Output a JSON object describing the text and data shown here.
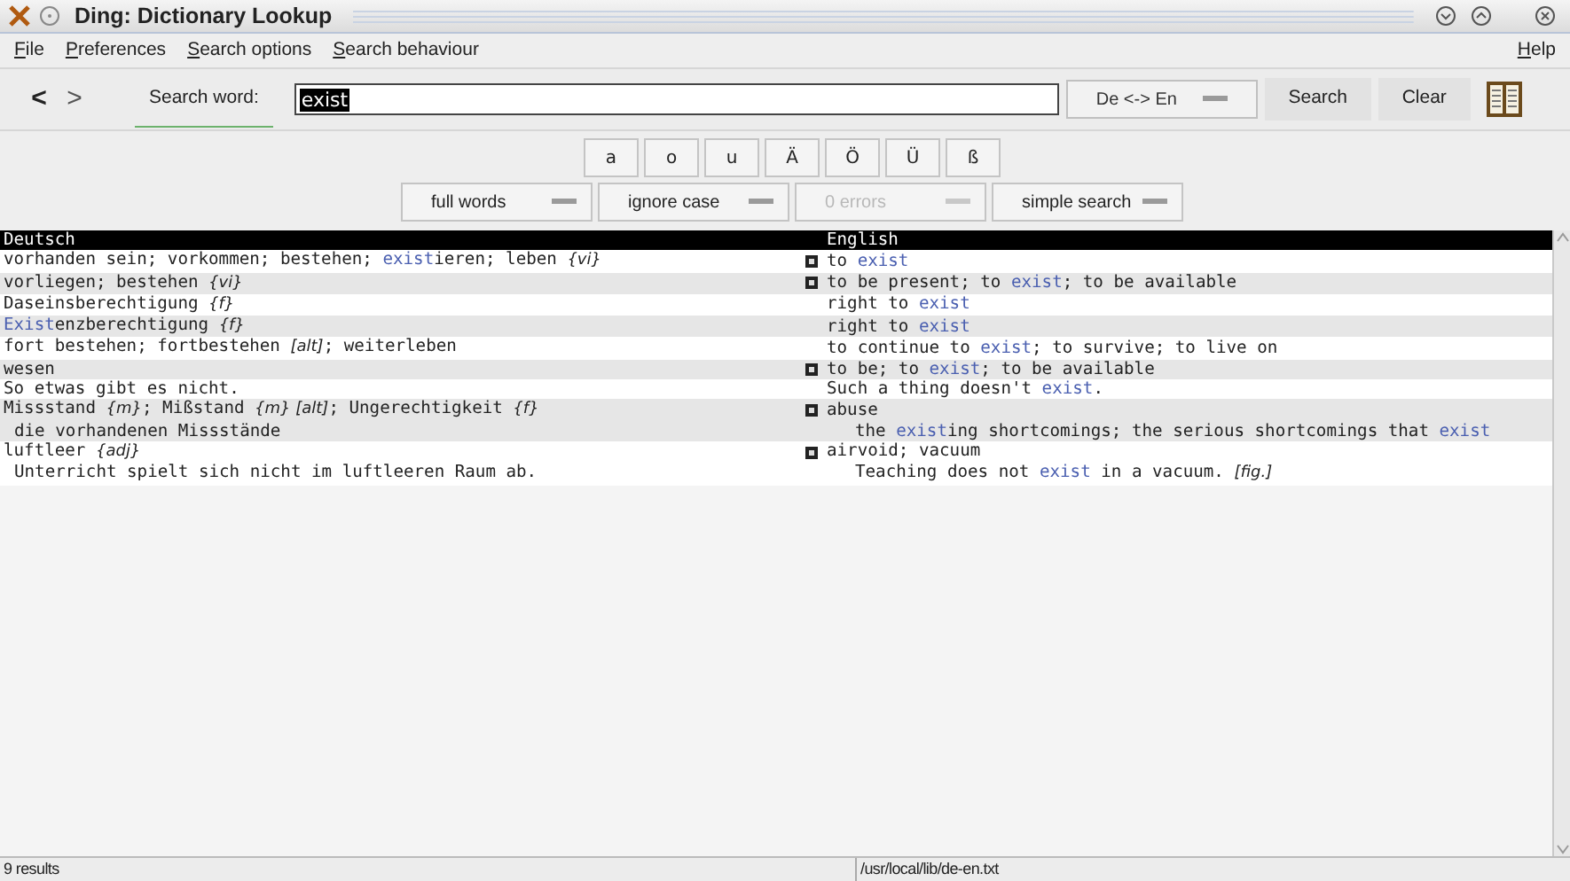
{
  "window": {
    "title": "Ding: Dictionary Lookup"
  },
  "menu": {
    "left": [
      "File",
      "Preferences",
      "Search options",
      "Search behaviour"
    ],
    "right": "Help"
  },
  "toolbar": {
    "back": "<",
    "forward": ">",
    "label": "Search word:",
    "value": "exist",
    "language": "De <-> En",
    "search": "Search",
    "clear": "Clear"
  },
  "special_chars": [
    "a",
    "o",
    "u",
    "Ä",
    "Ö",
    "Ü",
    "ß"
  ],
  "options": [
    {
      "label": "full words",
      "disabled": false
    },
    {
      "label": "ignore case",
      "disabled": false
    },
    {
      "label": "0 errors",
      "disabled": true
    },
    {
      "label": "simple search",
      "disabled": false
    }
  ],
  "table": {
    "columns": [
      "Deutsch",
      "English"
    ],
    "rows": [
      {
        "marker": true,
        "de": [
          {
            "kind": "plain",
            "text": "vorhanden sein; vorkommen; bestehen; "
          },
          {
            "kind": "match",
            "text": "exist"
          },
          {
            "kind": "plain",
            "text": "ieren; leben "
          },
          {
            "kind": "note",
            "text": "{vi}"
          }
        ],
        "en": [
          {
            "kind": "plain",
            "text": "to "
          },
          {
            "kind": "match",
            "text": "exist"
          }
        ]
      },
      {
        "marker": true,
        "de": [
          {
            "kind": "plain",
            "text": "vorliegen; bestehen "
          },
          {
            "kind": "note",
            "text": "{vi}"
          }
        ],
        "en": [
          {
            "kind": "plain",
            "text": "to be present; to "
          },
          {
            "kind": "match",
            "text": "exist"
          },
          {
            "kind": "plain",
            "text": "; to be available"
          }
        ]
      },
      {
        "marker": false,
        "de": [
          {
            "kind": "plain",
            "text": "Daseinsberechtigung "
          },
          {
            "kind": "note",
            "text": "{f}"
          }
        ],
        "en": [
          {
            "kind": "plain",
            "text": "right to "
          },
          {
            "kind": "match",
            "text": "exist"
          }
        ]
      },
      {
        "marker": false,
        "de": [
          {
            "kind": "match",
            "text": "Exist"
          },
          {
            "kind": "plain",
            "text": "enzberechtigung "
          },
          {
            "kind": "note",
            "text": "{f}"
          }
        ],
        "en": [
          {
            "kind": "plain",
            "text": "right to "
          },
          {
            "kind": "match",
            "text": "exist"
          }
        ]
      },
      {
        "marker": false,
        "de": [
          {
            "kind": "plain",
            "text": "fort bestehen; fortbestehen "
          },
          {
            "kind": "note",
            "text": "[alt]"
          },
          {
            "kind": "plain",
            "text": "; weiterleben"
          }
        ],
        "en": [
          {
            "kind": "plain",
            "text": "to continue to "
          },
          {
            "kind": "match",
            "text": "exist"
          },
          {
            "kind": "plain",
            "text": "; to survive; to live on"
          }
        ]
      },
      {
        "marker": true,
        "de": [
          {
            "kind": "plain",
            "text": "wesen"
          }
        ],
        "en": [
          {
            "kind": "plain",
            "text": "to be; to "
          },
          {
            "kind": "match",
            "text": "exist"
          },
          {
            "kind": "plain",
            "text": "; to be available"
          }
        ]
      },
      {
        "marker": false,
        "de": [
          {
            "kind": "plain",
            "text": "So etwas gibt es nicht."
          }
        ],
        "en": [
          {
            "kind": "plain",
            "text": "Such a thing doesn't "
          },
          {
            "kind": "match",
            "text": "exist"
          },
          {
            "kind": "plain",
            "text": "."
          }
        ]
      },
      {
        "marker": true,
        "de": [
          {
            "kind": "plain",
            "text": "Missstand "
          },
          {
            "kind": "note",
            "text": "{m}"
          },
          {
            "kind": "plain",
            "text": "; Mißstand "
          },
          {
            "kind": "note",
            "text": "{m} [alt]"
          },
          {
            "kind": "plain",
            "text": "; Ungerechtigkeit "
          },
          {
            "kind": "note",
            "text": "{f}"
          }
        ],
        "en": [
          {
            "kind": "plain",
            "text": "abuse"
          }
        ],
        "sub": {
          "de": [
            {
              "kind": "plain",
              "text": "die vorhandenen Missstände"
            }
          ],
          "en": [
            {
              "kind": "plain",
              "text": "the "
            },
            {
              "kind": "match",
              "text": "exist"
            },
            {
              "kind": "plain",
              "text": "ing shortcomings; the serious shortcomings that "
            },
            {
              "kind": "match",
              "text": "exist"
            }
          ]
        }
      },
      {
        "marker": true,
        "de": [
          {
            "kind": "plain",
            "text": "luftleer "
          },
          {
            "kind": "note",
            "text": "{adj}"
          }
        ],
        "en": [
          {
            "kind": "plain",
            "text": "airvoid; vacuum"
          }
        ],
        "sub": {
          "de": [
            {
              "kind": "plain",
              "text": "Unterricht spielt sich nicht im luftleeren Raum ab."
            }
          ],
          "en": [
            {
              "kind": "plain",
              "text": "Teaching does not "
            },
            {
              "kind": "match",
              "text": "exist"
            },
            {
              "kind": "plain",
              "text": " in a vacuum. "
            },
            {
              "kind": "note",
              "text": "[fig.]"
            }
          ]
        }
      }
    ]
  },
  "status_bar": {
    "left": "9 results",
    "right": "/usr/local/lib/de-en.txt"
  }
}
